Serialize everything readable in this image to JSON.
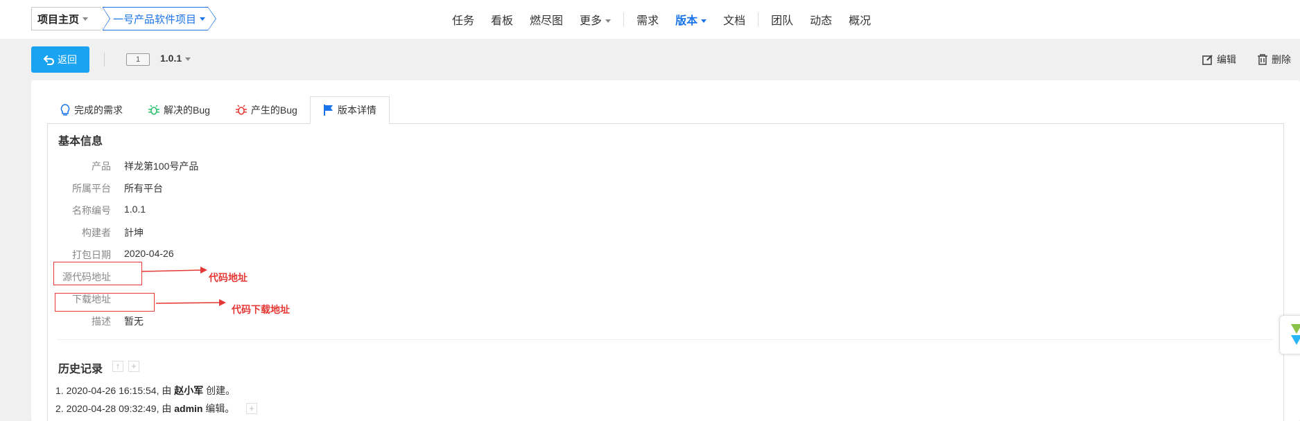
{
  "breadcrumb": {
    "home_label": "项目主页",
    "project_label": "一号产品软件项目"
  },
  "nav": {
    "items": [
      {
        "label": "任务"
      },
      {
        "label": "看板"
      },
      {
        "label": "燃尽图"
      },
      {
        "label": "更多"
      },
      {
        "label": "需求"
      },
      {
        "label": "版本"
      },
      {
        "label": "文档"
      },
      {
        "label": "团队"
      },
      {
        "label": "动态"
      },
      {
        "label": "概况"
      }
    ],
    "active": "版本"
  },
  "toolbar": {
    "back_label": "返回",
    "build_id": "1",
    "build_name": "1.0.1",
    "edit_label": "编辑",
    "delete_label": "删除"
  },
  "tabs": [
    {
      "label": "完成的需求",
      "icon": "lightbulb-icon",
      "color": "#1a73e8"
    },
    {
      "label": "解决的Bug",
      "icon": "bug-icon",
      "color": "#2bbf6a"
    },
    {
      "label": "产生的Bug",
      "icon": "bug-icon",
      "color": "#e53935"
    },
    {
      "label": "版本详情",
      "icon": "flag-icon",
      "color": "#1a73e8"
    }
  ],
  "basic_info": {
    "title": "基本信息",
    "rows": [
      {
        "label": "产品",
        "value": "祥龙第100号产品"
      },
      {
        "label": "所属平台",
        "value": "所有平台"
      },
      {
        "label": "名称编号",
        "value": "1.0.1"
      },
      {
        "label": "构建者",
        "value": "計坤"
      },
      {
        "label": "打包日期",
        "value": "2020-04-26"
      },
      {
        "label": "源代码地址",
        "value": ""
      },
      {
        "label": "下载地址",
        "value": ""
      },
      {
        "label": "描述",
        "value": "暂无"
      }
    ]
  },
  "annotations": {
    "source_code": "代码地址",
    "download": "代码下载地址",
    "color": "#e53935"
  },
  "history": {
    "title": "历史记录",
    "entries": [
      {
        "prefix": "1. 2020-04-26 16:15:54, 由 ",
        "user": "赵小军",
        "action": " 创建。"
      },
      {
        "prefix": "2. 2020-04-28 09:32:49, 由 ",
        "user": "admin",
        "action": " 编辑。"
      }
    ]
  },
  "colors": {
    "accent": "#1a73e8",
    "back_button": "#1aa3f0"
  }
}
